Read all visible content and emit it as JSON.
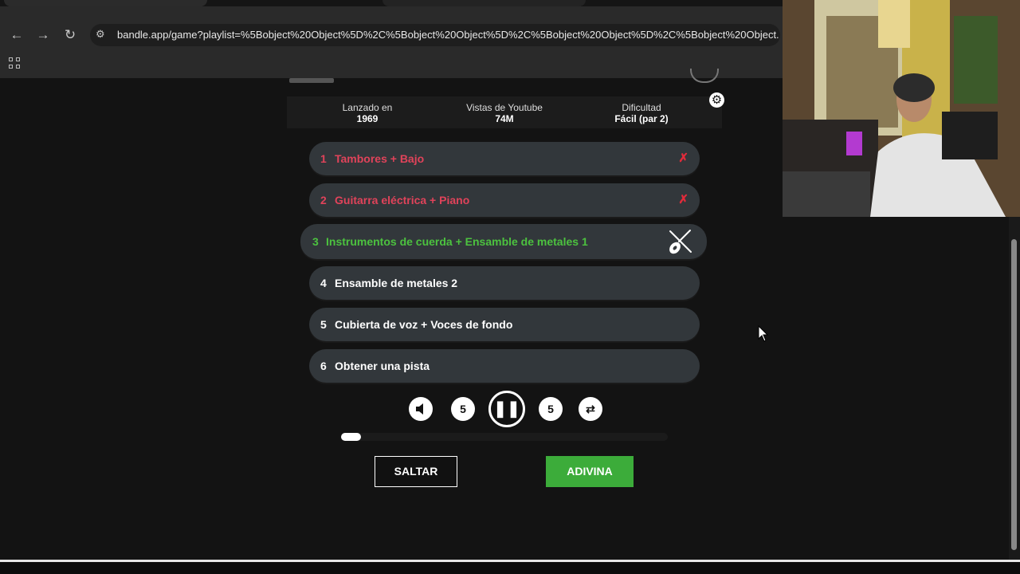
{
  "browser": {
    "url": "bandle.app/game?playlist=%5Bobject%20Object%5D%2C%5Bobject%20Object%5D%2C%5Bobject%20Object%5D%2C%5Bobject%20Object..."
  },
  "stats": {
    "released_label": "Lanzado en",
    "released_value": "1969",
    "views_label": "Vistas de Youtube",
    "views_value": "74M",
    "difficulty_label": "Dificultad",
    "difficulty_value": "Fácil (par 2)"
  },
  "tracks": [
    {
      "num": "1",
      "label": "Tambores + Bajo",
      "state": "wrong",
      "mark": "✗"
    },
    {
      "num": "2",
      "label": "Guitarra eléctrica + Piano",
      "state": "wrong",
      "mark": "✗"
    },
    {
      "num": "3",
      "label": "Instrumentos de cuerda + Ensamble de metales 1",
      "state": "active",
      "icon": "violin-icon"
    },
    {
      "num": "4",
      "label": "Ensamble de metales 2",
      "state": "locked"
    },
    {
      "num": "5",
      "label": "Cubierta de voz + Voces de fondo",
      "state": "locked"
    },
    {
      "num": "6",
      "label": "Obtener una pista",
      "state": "locked"
    }
  ],
  "controls": {
    "rewind_label": "5",
    "forward_label": "5"
  },
  "playback": {
    "progress_fraction": 0.06
  },
  "buttons": {
    "skip_label": "SALTAR",
    "guess_label": "ADIVINA"
  },
  "colors": {
    "wrong": "#e0435a",
    "active": "#4cc23f",
    "guess_button": "#3cac3a",
    "track_bg": "#32373b"
  }
}
